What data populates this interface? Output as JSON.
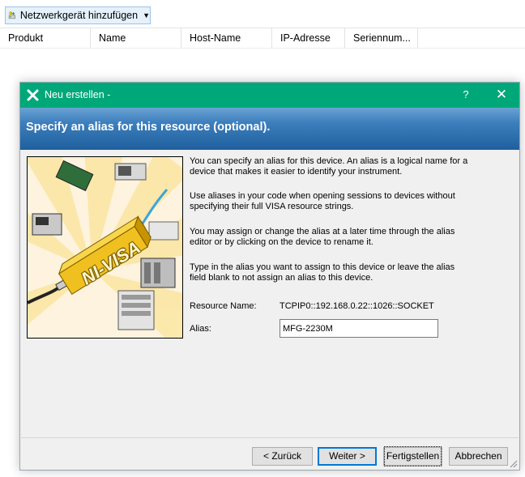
{
  "toolbar": {
    "add_device_label": "Netzwerkgerät hinzufügen"
  },
  "table": {
    "columns": [
      "Produkt",
      "Name",
      "Host-Name",
      "IP-Adresse",
      "Seriennum..."
    ]
  },
  "dialog": {
    "title": "Neu erstellen -",
    "help_glyph": "?",
    "close_glyph": "✕",
    "heading": "Specify an alias for this resource (optional).",
    "picture_label": "NI-VISA",
    "paragraphs": [
      "You can specify an alias for this device. An alias is a logical name for a device that makes it easier to identify your instrument.",
      "Use aliases in your code when opening sessions to devices without specifying their full VISA resource strings.",
      "You may assign or change the alias at a later time through the alias editor or by clicking on the device to rename it.",
      "Type in the alias you want to assign to this device or leave the alias field blank to not assign an alias to this device."
    ],
    "resource_name_label": "Resource Name:",
    "resource_name_value": "TCPIP0::192.168.0.22::1026::SOCKET",
    "alias_label": "Alias:",
    "alias_value": "MFG-2230M",
    "buttons": {
      "back": "< Zurück",
      "next": "Weiter >",
      "finish": "Fertigstellen",
      "cancel": "Abbrechen"
    }
  },
  "colors": {
    "titlebar": "#00a879",
    "banner": "#2f70b0",
    "picture_bg": "#fdf3de",
    "picture_bar": "#f0c020"
  }
}
